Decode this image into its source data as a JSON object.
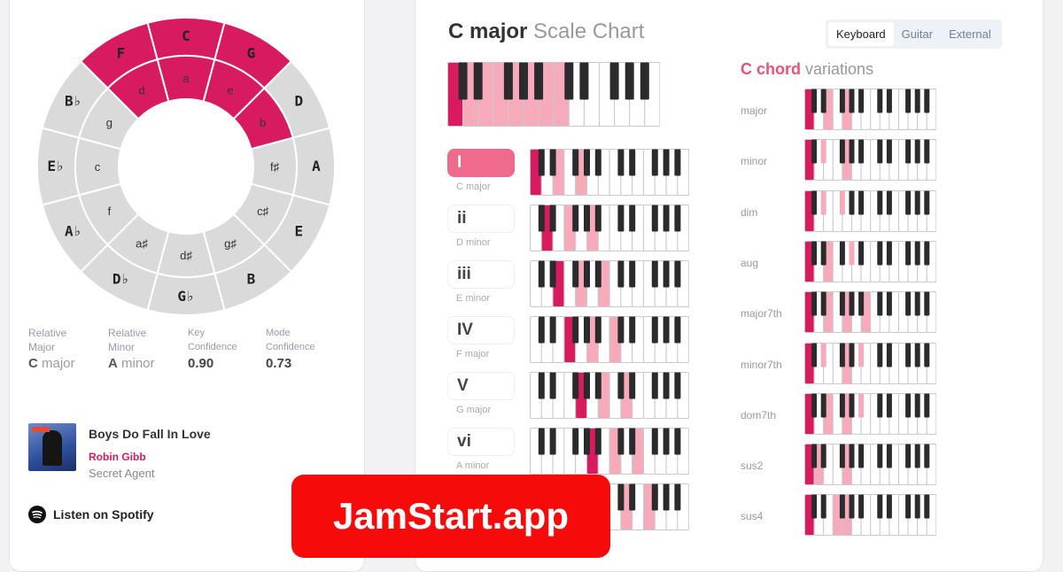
{
  "circle": {
    "outer": [
      {
        "label": "C",
        "active": true
      },
      {
        "label": "G",
        "active": true
      },
      {
        "label": "D",
        "active": false
      },
      {
        "label": "A",
        "active": false
      },
      {
        "label": "E",
        "active": false
      },
      {
        "label": "B",
        "active": false
      },
      {
        "label": "G♭",
        "active": false
      },
      {
        "label": "D♭",
        "active": false
      },
      {
        "label": "A♭",
        "active": false
      },
      {
        "label": "E♭",
        "active": false
      },
      {
        "label": "B♭",
        "active": false
      },
      {
        "label": "F",
        "active": true
      }
    ],
    "inner": [
      {
        "label": "a",
        "active": true
      },
      {
        "label": "e",
        "active": true
      },
      {
        "label": "b",
        "active": true
      },
      {
        "label": "f♯",
        "active": false
      },
      {
        "label": "c♯",
        "active": false
      },
      {
        "label": "g♯",
        "active": false
      },
      {
        "label": "d♯",
        "active": false
      },
      {
        "label": "a♯",
        "active": false
      },
      {
        "label": "f",
        "active": false
      },
      {
        "label": "c",
        "active": false
      },
      {
        "label": "g",
        "active": false
      },
      {
        "label": "d",
        "active": true
      }
    ],
    "colors": {
      "active": "#d81b60",
      "inactive": "#dadada",
      "border": "#ffffff"
    }
  },
  "stats": {
    "relative_major_label": "Relative Major",
    "relative_major_value_note": "C",
    "relative_major_value_mode": "major",
    "relative_minor_label": "Relative Minor",
    "relative_minor_value_note": "A",
    "relative_minor_value_mode": "minor",
    "key_confidence_label": "Key Confidence",
    "key_confidence_value": "0.90",
    "mode_confidence_label": "Mode Confidence",
    "mode_confidence_value": "0.73"
  },
  "track": {
    "title": "Boys Do Fall In Love",
    "artist": "Robin Gibb",
    "album": "Secret Agent",
    "spotify_label": "Listen on Spotify",
    "spotify_icon": "spotify-icon"
  },
  "scale": {
    "key": "C major",
    "title_rest": "Scale Chart",
    "tabs": [
      "Keyboard",
      "Guitar",
      "External"
    ],
    "active_tab": 0,
    "scale_keys": [
      0,
      2,
      4,
      5,
      7,
      9,
      11,
      12
    ],
    "colors": {
      "root": "#d81b60",
      "highlight": "#f7aab9"
    }
  },
  "degrees": [
    {
      "roman": "I",
      "name": "C major",
      "notes": [
        0,
        4,
        7
      ],
      "active": true
    },
    {
      "roman": "ii",
      "name": "D minor",
      "notes": [
        2,
        5,
        9
      ],
      "active": false
    },
    {
      "roman": "iii",
      "name": "E minor",
      "notes": [
        4,
        7,
        11
      ],
      "active": false
    },
    {
      "roman": "IV",
      "name": "F major",
      "notes": [
        5,
        9,
        12
      ],
      "active": false
    },
    {
      "roman": "V",
      "name": "G major",
      "notes": [
        7,
        11,
        14
      ],
      "active": false
    },
    {
      "roman": "vi",
      "name": "A minor",
      "notes": [
        9,
        12,
        16
      ],
      "active": false
    },
    {
      "roman": "",
      "name": "",
      "notes": [
        11,
        14,
        17
      ],
      "active": false
    }
  ],
  "variations": {
    "note": "C",
    "title_bold": "C chord",
    "title_rest": "variations",
    "items": [
      {
        "label": "major",
        "notes": [
          0,
          4,
          7
        ]
      },
      {
        "label": "minor",
        "notes": [
          0,
          3,
          7
        ]
      },
      {
        "label": "dim",
        "notes": [
          0,
          3,
          6
        ]
      },
      {
        "label": "aug",
        "notes": [
          0,
          4,
          8
        ]
      },
      {
        "label": "major7th",
        "notes": [
          0,
          4,
          7,
          11
        ]
      },
      {
        "label": "minor7th",
        "notes": [
          0,
          3,
          7,
          10
        ]
      },
      {
        "label": "dom7th",
        "notes": [
          0,
          4,
          7,
          10
        ]
      },
      {
        "label": "sus2",
        "notes": [
          0,
          2,
          7
        ]
      },
      {
        "label": "sus4",
        "notes": [
          0,
          5,
          7
        ]
      }
    ]
  },
  "brand": {
    "label": "JamStart.app"
  }
}
